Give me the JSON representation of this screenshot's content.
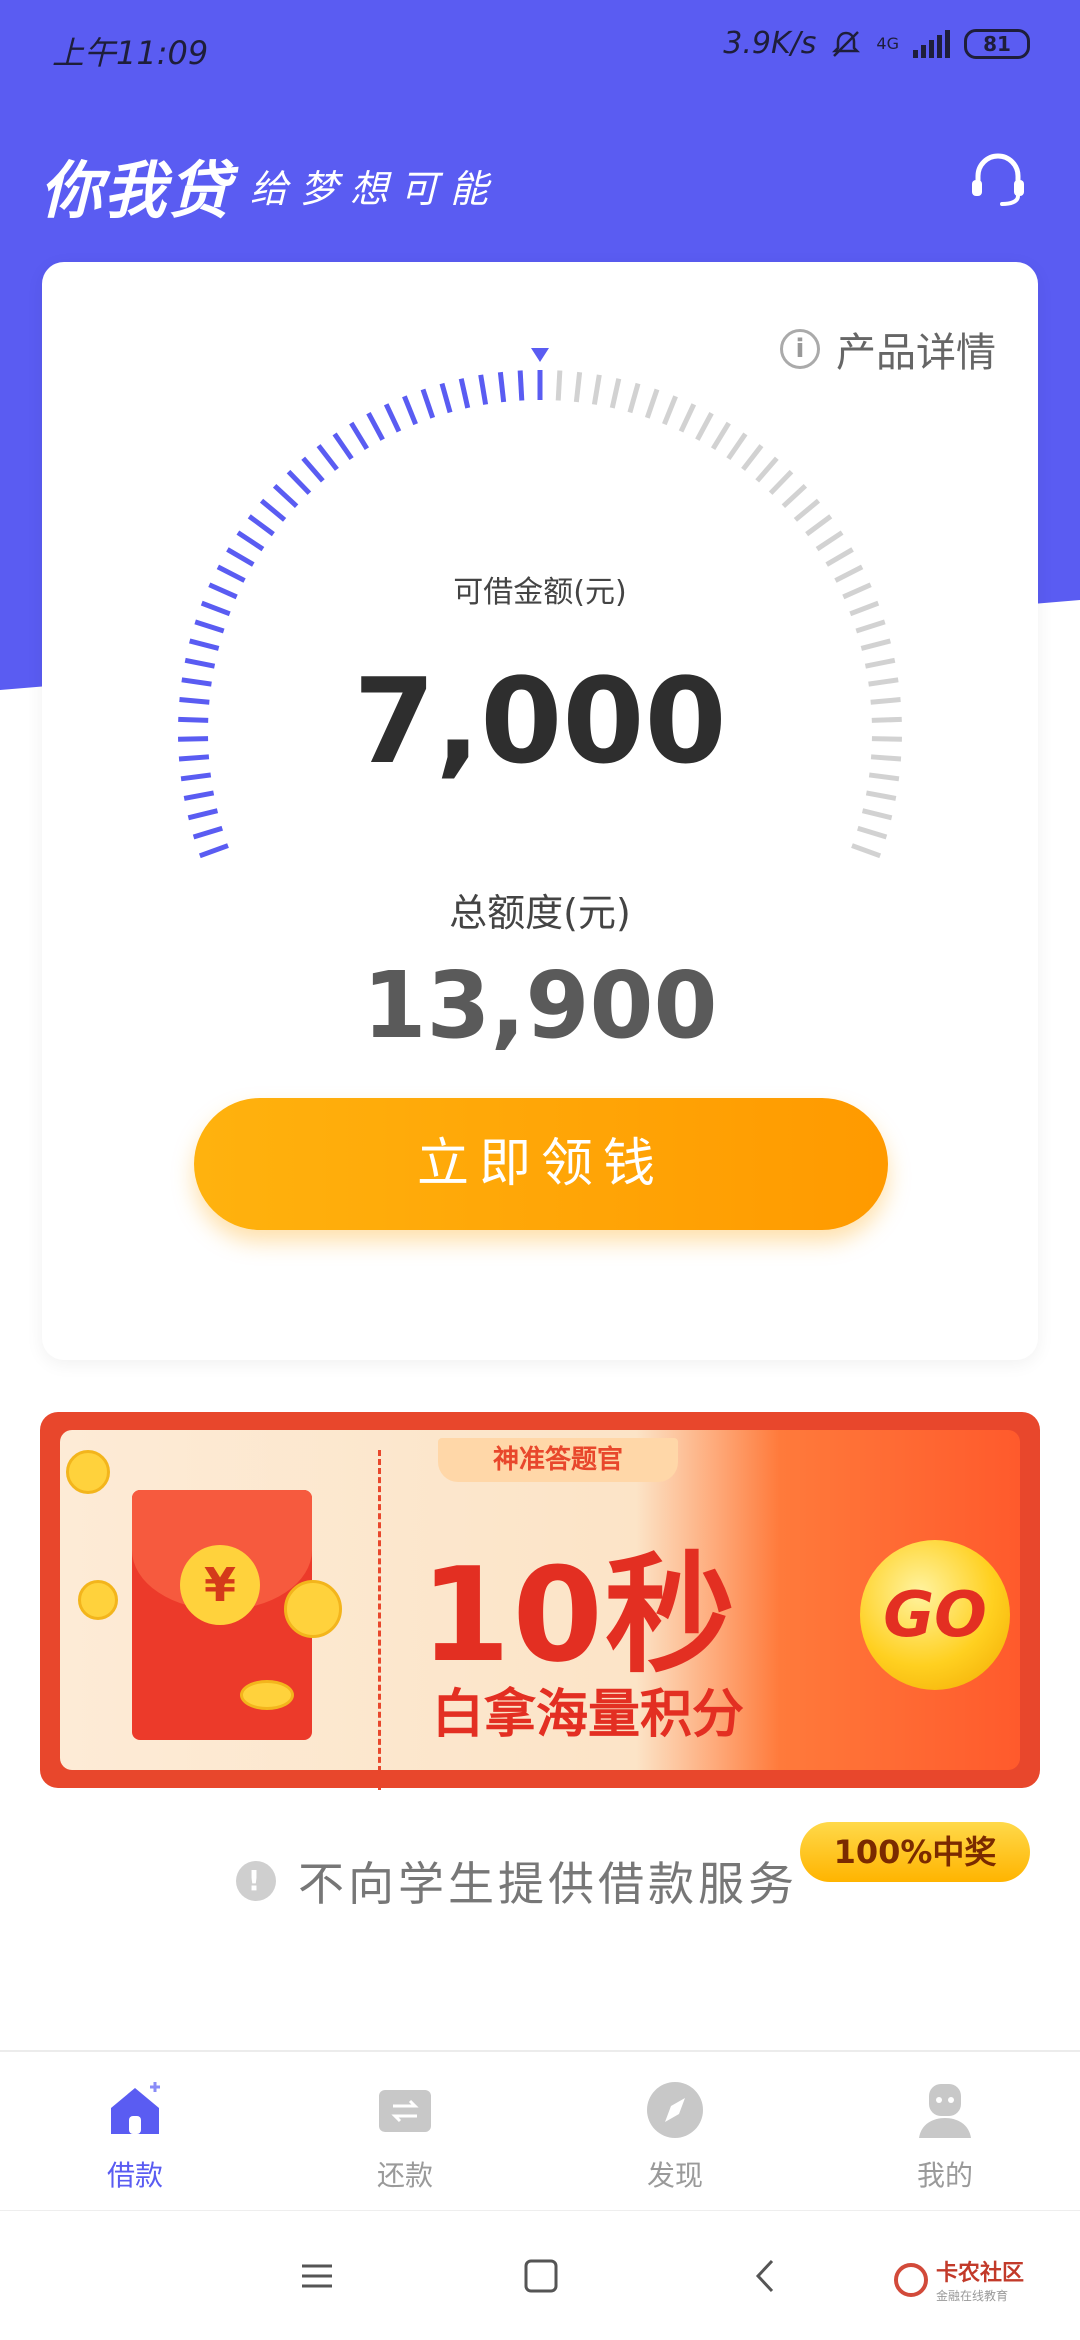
{
  "status_bar": {
    "time": "上午11:09",
    "speed": "3.9K/s",
    "network": "4G",
    "battery": "81"
  },
  "header": {
    "brand": "你我贷",
    "slogan": "给梦想可能",
    "support_icon": "headset-icon"
  },
  "card": {
    "product_details": "产品详情",
    "available_label": "可借金额(元)",
    "available_amount": "7,000",
    "total_label": "总额度(元)",
    "total_amount": "13,900",
    "gauge_fraction": 0.5,
    "cta_label": "立即领钱",
    "colors": {
      "active": "#5a5cf2",
      "inactive": "#d2d2d2",
      "cta": "#ffa50a"
    }
  },
  "banner": {
    "tag": "神准答题官",
    "headline": "10秒",
    "subline": "白拿海量积分",
    "go_label": "GO",
    "prize_badge": "100%中奖",
    "currency_symbol": "¥"
  },
  "notice": {
    "text": "不向学生提供借款服务"
  },
  "bottom_nav": {
    "items": [
      {
        "label": "借款",
        "icon": "home-icon",
        "active": true
      },
      {
        "label": "还款",
        "icon": "repay-icon",
        "active": false
      },
      {
        "label": "发现",
        "icon": "compass-icon",
        "active": false
      },
      {
        "label": "我的",
        "icon": "profile-icon",
        "active": false
      }
    ]
  },
  "watermark": {
    "title": "卡农社区",
    "subtitle": "金融在线教育"
  }
}
